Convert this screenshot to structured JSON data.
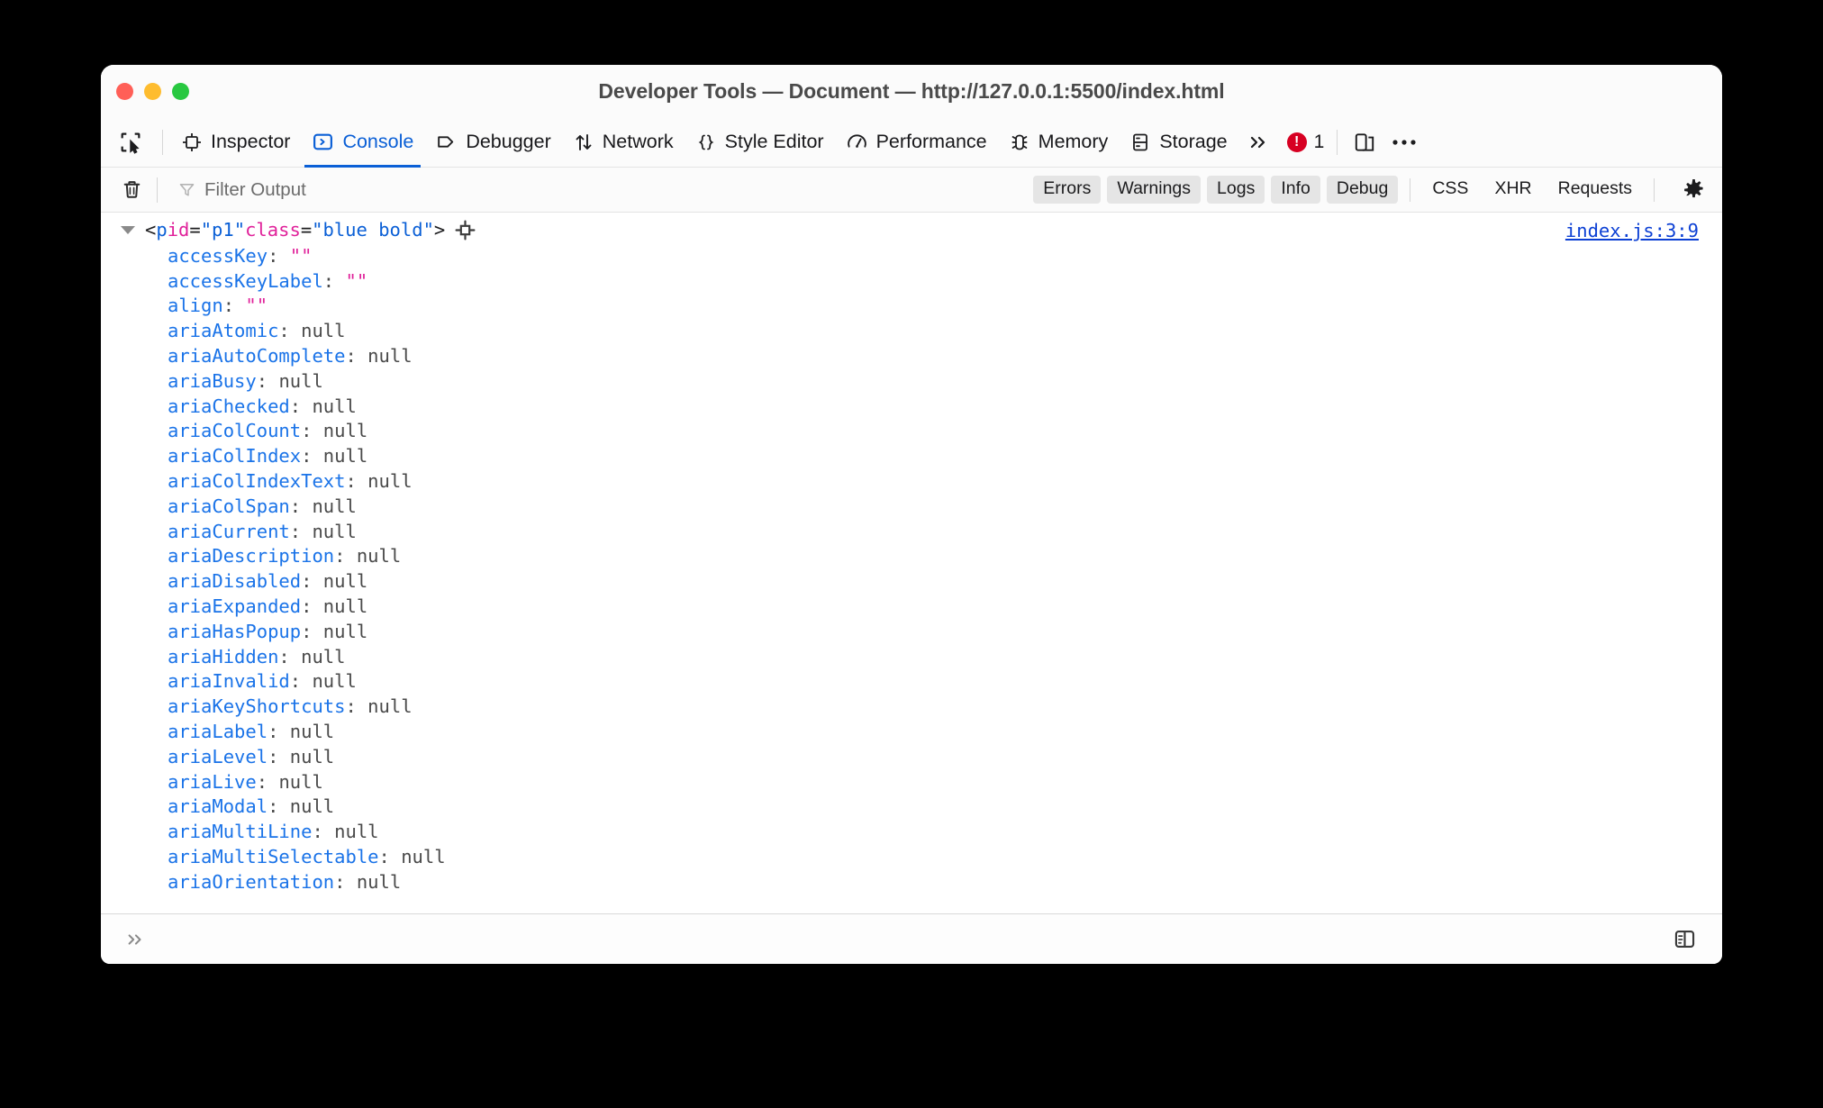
{
  "window": {
    "title": "Developer Tools — Document — http://127.0.0.1:5500/index.html",
    "traffic_lights": {
      "close": "close-window",
      "minimize": "minimize-window",
      "maximize": "maximize-window",
      "close_color": "#ff5f57",
      "minimize_color": "#febc2e",
      "maximize_color": "#28c840"
    }
  },
  "toolbar": {
    "picker_label": "Pick an element from the page",
    "tabs": [
      {
        "label": "Inspector",
        "icon": "inspector-icon",
        "active": false
      },
      {
        "label": "Console",
        "icon": "console-icon",
        "active": true
      },
      {
        "label": "Debugger",
        "icon": "debugger-icon",
        "active": false
      },
      {
        "label": "Network",
        "icon": "network-icon",
        "active": false
      },
      {
        "label": "Style Editor",
        "icon": "style-editor-icon",
        "active": false
      },
      {
        "label": "Performance",
        "icon": "performance-icon",
        "active": false
      },
      {
        "label": "Memory",
        "icon": "memory-icon",
        "active": false
      },
      {
        "label": "Storage",
        "icon": "storage-icon",
        "active": false
      }
    ],
    "overflow_label": "»",
    "error_count": "1",
    "responsive_label": "Responsive Design Mode",
    "menu_label": "•••",
    "accent_color": "#0a5fd6",
    "error_color": "#d70022"
  },
  "filterbar": {
    "clear_label": "Clear console output",
    "filter_placeholder": "Filter Output",
    "pills": [
      {
        "label": "Errors",
        "active": true
      },
      {
        "label": "Warnings",
        "active": true
      },
      {
        "label": "Logs",
        "active": true
      },
      {
        "label": "Info",
        "active": true
      },
      {
        "label": "Debug",
        "active": true
      },
      {
        "label": "CSS",
        "active": false
      },
      {
        "label": "XHR",
        "active": false
      },
      {
        "label": "Requests",
        "active": false
      }
    ],
    "settings_label": "Console settings"
  },
  "console": {
    "message": {
      "expanded": true,
      "node_parts": {
        "open_angle": "<",
        "tag": "p",
        "space1": " ",
        "attr1_name": "id",
        "attr1_eq": "=",
        "attr1_value": "\"p1\"",
        "space2": " ",
        "attr2_name": "class",
        "attr2_eq": "=",
        "attr2_value": "\"blue bold\"",
        "close_angle": ">"
      },
      "node_text": "<p id=\"p1\" class=\"blue bold\">",
      "source_link": "index.js:3:9",
      "inspect_icon": "inspect-node-icon"
    },
    "properties": [
      {
        "name": "accessKey",
        "value": "\"\"",
        "type": "string"
      },
      {
        "name": "accessKeyLabel",
        "value": "\"\"",
        "type": "string"
      },
      {
        "name": "align",
        "value": "\"\"",
        "type": "string"
      },
      {
        "name": "ariaAtomic",
        "value": "null",
        "type": "null"
      },
      {
        "name": "ariaAutoComplete",
        "value": "null",
        "type": "null"
      },
      {
        "name": "ariaBusy",
        "value": "null",
        "type": "null"
      },
      {
        "name": "ariaChecked",
        "value": "null",
        "type": "null"
      },
      {
        "name": "ariaColCount",
        "value": "null",
        "type": "null"
      },
      {
        "name": "ariaColIndex",
        "value": "null",
        "type": "null"
      },
      {
        "name": "ariaColIndexText",
        "value": "null",
        "type": "null"
      },
      {
        "name": "ariaColSpan",
        "value": "null",
        "type": "null"
      },
      {
        "name": "ariaCurrent",
        "value": "null",
        "type": "null"
      },
      {
        "name": "ariaDescription",
        "value": "null",
        "type": "null"
      },
      {
        "name": "ariaDisabled",
        "value": "null",
        "type": "null"
      },
      {
        "name": "ariaExpanded",
        "value": "null",
        "type": "null"
      },
      {
        "name": "ariaHasPopup",
        "value": "null",
        "type": "null"
      },
      {
        "name": "ariaHidden",
        "value": "null",
        "type": "null"
      },
      {
        "name": "ariaInvalid",
        "value": "null",
        "type": "null"
      },
      {
        "name": "ariaKeyShortcuts",
        "value": "null",
        "type": "null"
      },
      {
        "name": "ariaLabel",
        "value": "null",
        "type": "null"
      },
      {
        "name": "ariaLevel",
        "value": "null",
        "type": "null"
      },
      {
        "name": "ariaLive",
        "value": "null",
        "type": "null"
      },
      {
        "name": "ariaModal",
        "value": "null",
        "type": "null"
      },
      {
        "name": "ariaMultiLine",
        "value": "null",
        "type": "null"
      },
      {
        "name": "ariaMultiSelectable",
        "value": "null",
        "type": "null"
      },
      {
        "name": "ariaOrientation",
        "value": "null",
        "type": "null"
      }
    ],
    "colors": {
      "property": "#1a73e8",
      "string": "#e0219a",
      "null": "#4a4a4a",
      "link": "#0b3fd4"
    }
  },
  "inputbar": {
    "prompt": "»",
    "input_value": "",
    "editor_toggle_label": "Switch to multi-line editor mode"
  }
}
